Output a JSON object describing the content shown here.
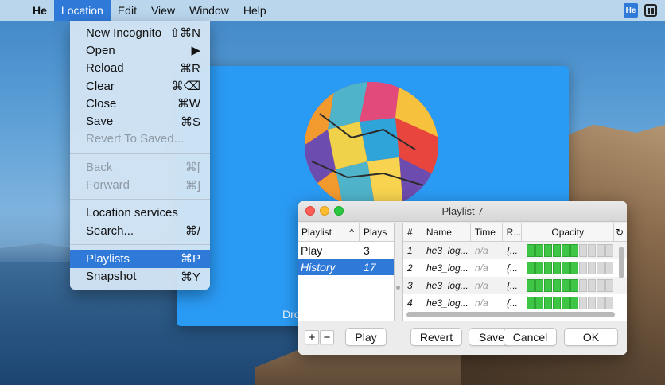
{
  "menubar": {
    "app_name": "He",
    "items": [
      "Location",
      "Edit",
      "View",
      "Window",
      "Help"
    ],
    "active": "Location",
    "status_badge": "He"
  },
  "location_menu": {
    "groups": [
      [
        {
          "label": "New Incognito",
          "shortcut": "⇧⌘N",
          "enabled": true
        },
        {
          "label": "Open",
          "shortcut": "▶",
          "enabled": true
        },
        {
          "label": "Reload",
          "shortcut": "⌘R",
          "enabled": true
        },
        {
          "label": "Clear",
          "shortcut": "⌘⌫",
          "enabled": true
        },
        {
          "label": "Close",
          "shortcut": "⌘W",
          "enabled": true
        },
        {
          "label": "Save",
          "shortcut": "⌘S",
          "enabled": true
        },
        {
          "label": "Revert To Saved...",
          "shortcut": "",
          "enabled": false
        }
      ],
      [
        {
          "label": "Back",
          "shortcut": "⌘[",
          "enabled": false
        },
        {
          "label": "Forward",
          "shortcut": "⌘]",
          "enabled": false
        }
      ],
      [
        {
          "label": "Location services",
          "shortcut": "",
          "enabled": true
        },
        {
          "label": "Search...",
          "shortcut": "⌘/",
          "enabled": true
        }
      ],
      [
        {
          "label": "Playlists",
          "shortcut": "⌘P",
          "enabled": true,
          "selected": true
        },
        {
          "label": "Snapshot",
          "shortcut": "⌘Y",
          "enabled": true
        }
      ]
    ]
  },
  "viewer": {
    "drop_text": "Dro"
  },
  "playlist_window": {
    "title": "Playlist 7",
    "left_table": {
      "headers": [
        "Playlist",
        "Plays"
      ],
      "sort_indicator": "^",
      "rows": [
        {
          "name": "Play",
          "plays": "3",
          "selected": false
        },
        {
          "name": "History",
          "plays": "17",
          "selected": true
        }
      ]
    },
    "right_table": {
      "headers": [
        "#",
        "Name",
        "Time",
        "R...",
        "Opacity"
      ],
      "rows": [
        {
          "n": "1",
          "name": "he3_log...",
          "time": "n/a",
          "r": "{...",
          "opacity_filled": 6,
          "opacity_total": 10
        },
        {
          "n": "2",
          "name": "he3_log...",
          "time": "n/a",
          "r": "{...",
          "opacity_filled": 6,
          "opacity_total": 10
        },
        {
          "n": "3",
          "name": "he3_log...",
          "time": "n/a",
          "r": "{...",
          "opacity_filled": 6,
          "opacity_total": 10
        },
        {
          "n": "4",
          "name": "he3_log...",
          "time": "n/a",
          "r": "{...",
          "opacity_filled": 6,
          "opacity_total": 10
        }
      ]
    },
    "buttons": {
      "add": "+",
      "remove": "−",
      "play": "Play",
      "revert": "Revert",
      "save": "Save",
      "cancel": "Cancel",
      "ok": "OK"
    }
  },
  "colors": {
    "accent": "#2f7ad9",
    "viewer_bg": "#2a9bf5",
    "opacity_on": "#3ec545"
  }
}
